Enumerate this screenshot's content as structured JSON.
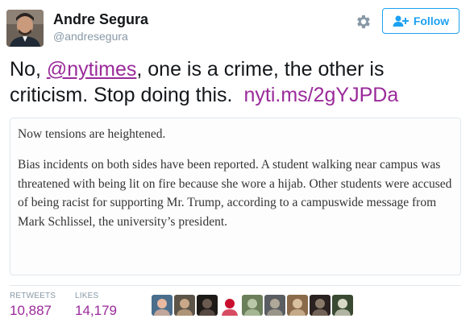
{
  "user": {
    "name": "Andre Segura",
    "handle": "@andresegura"
  },
  "actions": {
    "follow_label": "Follow"
  },
  "tweet": {
    "text_before": "No, ",
    "mention": "@nytimes",
    "text_after": ", one is a crime, the other is criticism. Stop doing this.",
    "link": "nyti.ms/2gYJPDa"
  },
  "quote_card": {
    "paragraph1": "Now tensions are heightened.",
    "paragraph2": "Bias incidents on both sides have been reported. A student walking near campus was threatened with being lit on fire because she wore a hijab. Other students were accused of being racist for supporting Mr. Trump, according to a campuswide message from Mark Schlissel, the university’s president."
  },
  "stats": {
    "retweets_label": "RETWEETS",
    "retweets_value": "10,887",
    "likes_label": "LIKES",
    "likes_value": "14,179"
  },
  "likers": [
    {
      "bg": "#4a6e8c",
      "fg": "#e8b9a0"
    },
    {
      "bg": "#5c5448",
      "fg": "#c8a888"
    },
    {
      "bg": "#1e1a18",
      "fg": "#6a5a50"
    },
    {
      "bg": "#ffffff",
      "fg": "#c8102e"
    },
    {
      "bg": "#6b7f5a",
      "fg": "#b8c8a8"
    },
    {
      "bg": "#5a5e62",
      "fg": "#b0a898"
    },
    {
      "bg": "#8a6a4a",
      "fg": "#d8c0a0"
    },
    {
      "bg": "#2a2220",
      "fg": "#8a7a6a"
    },
    {
      "bg": "#3a4a32",
      "fg": "#d8d8c8"
    }
  ],
  "colors": {
    "accent": "#1da1f2",
    "link": "#9a2a9a",
    "muted": "#8899a6"
  }
}
